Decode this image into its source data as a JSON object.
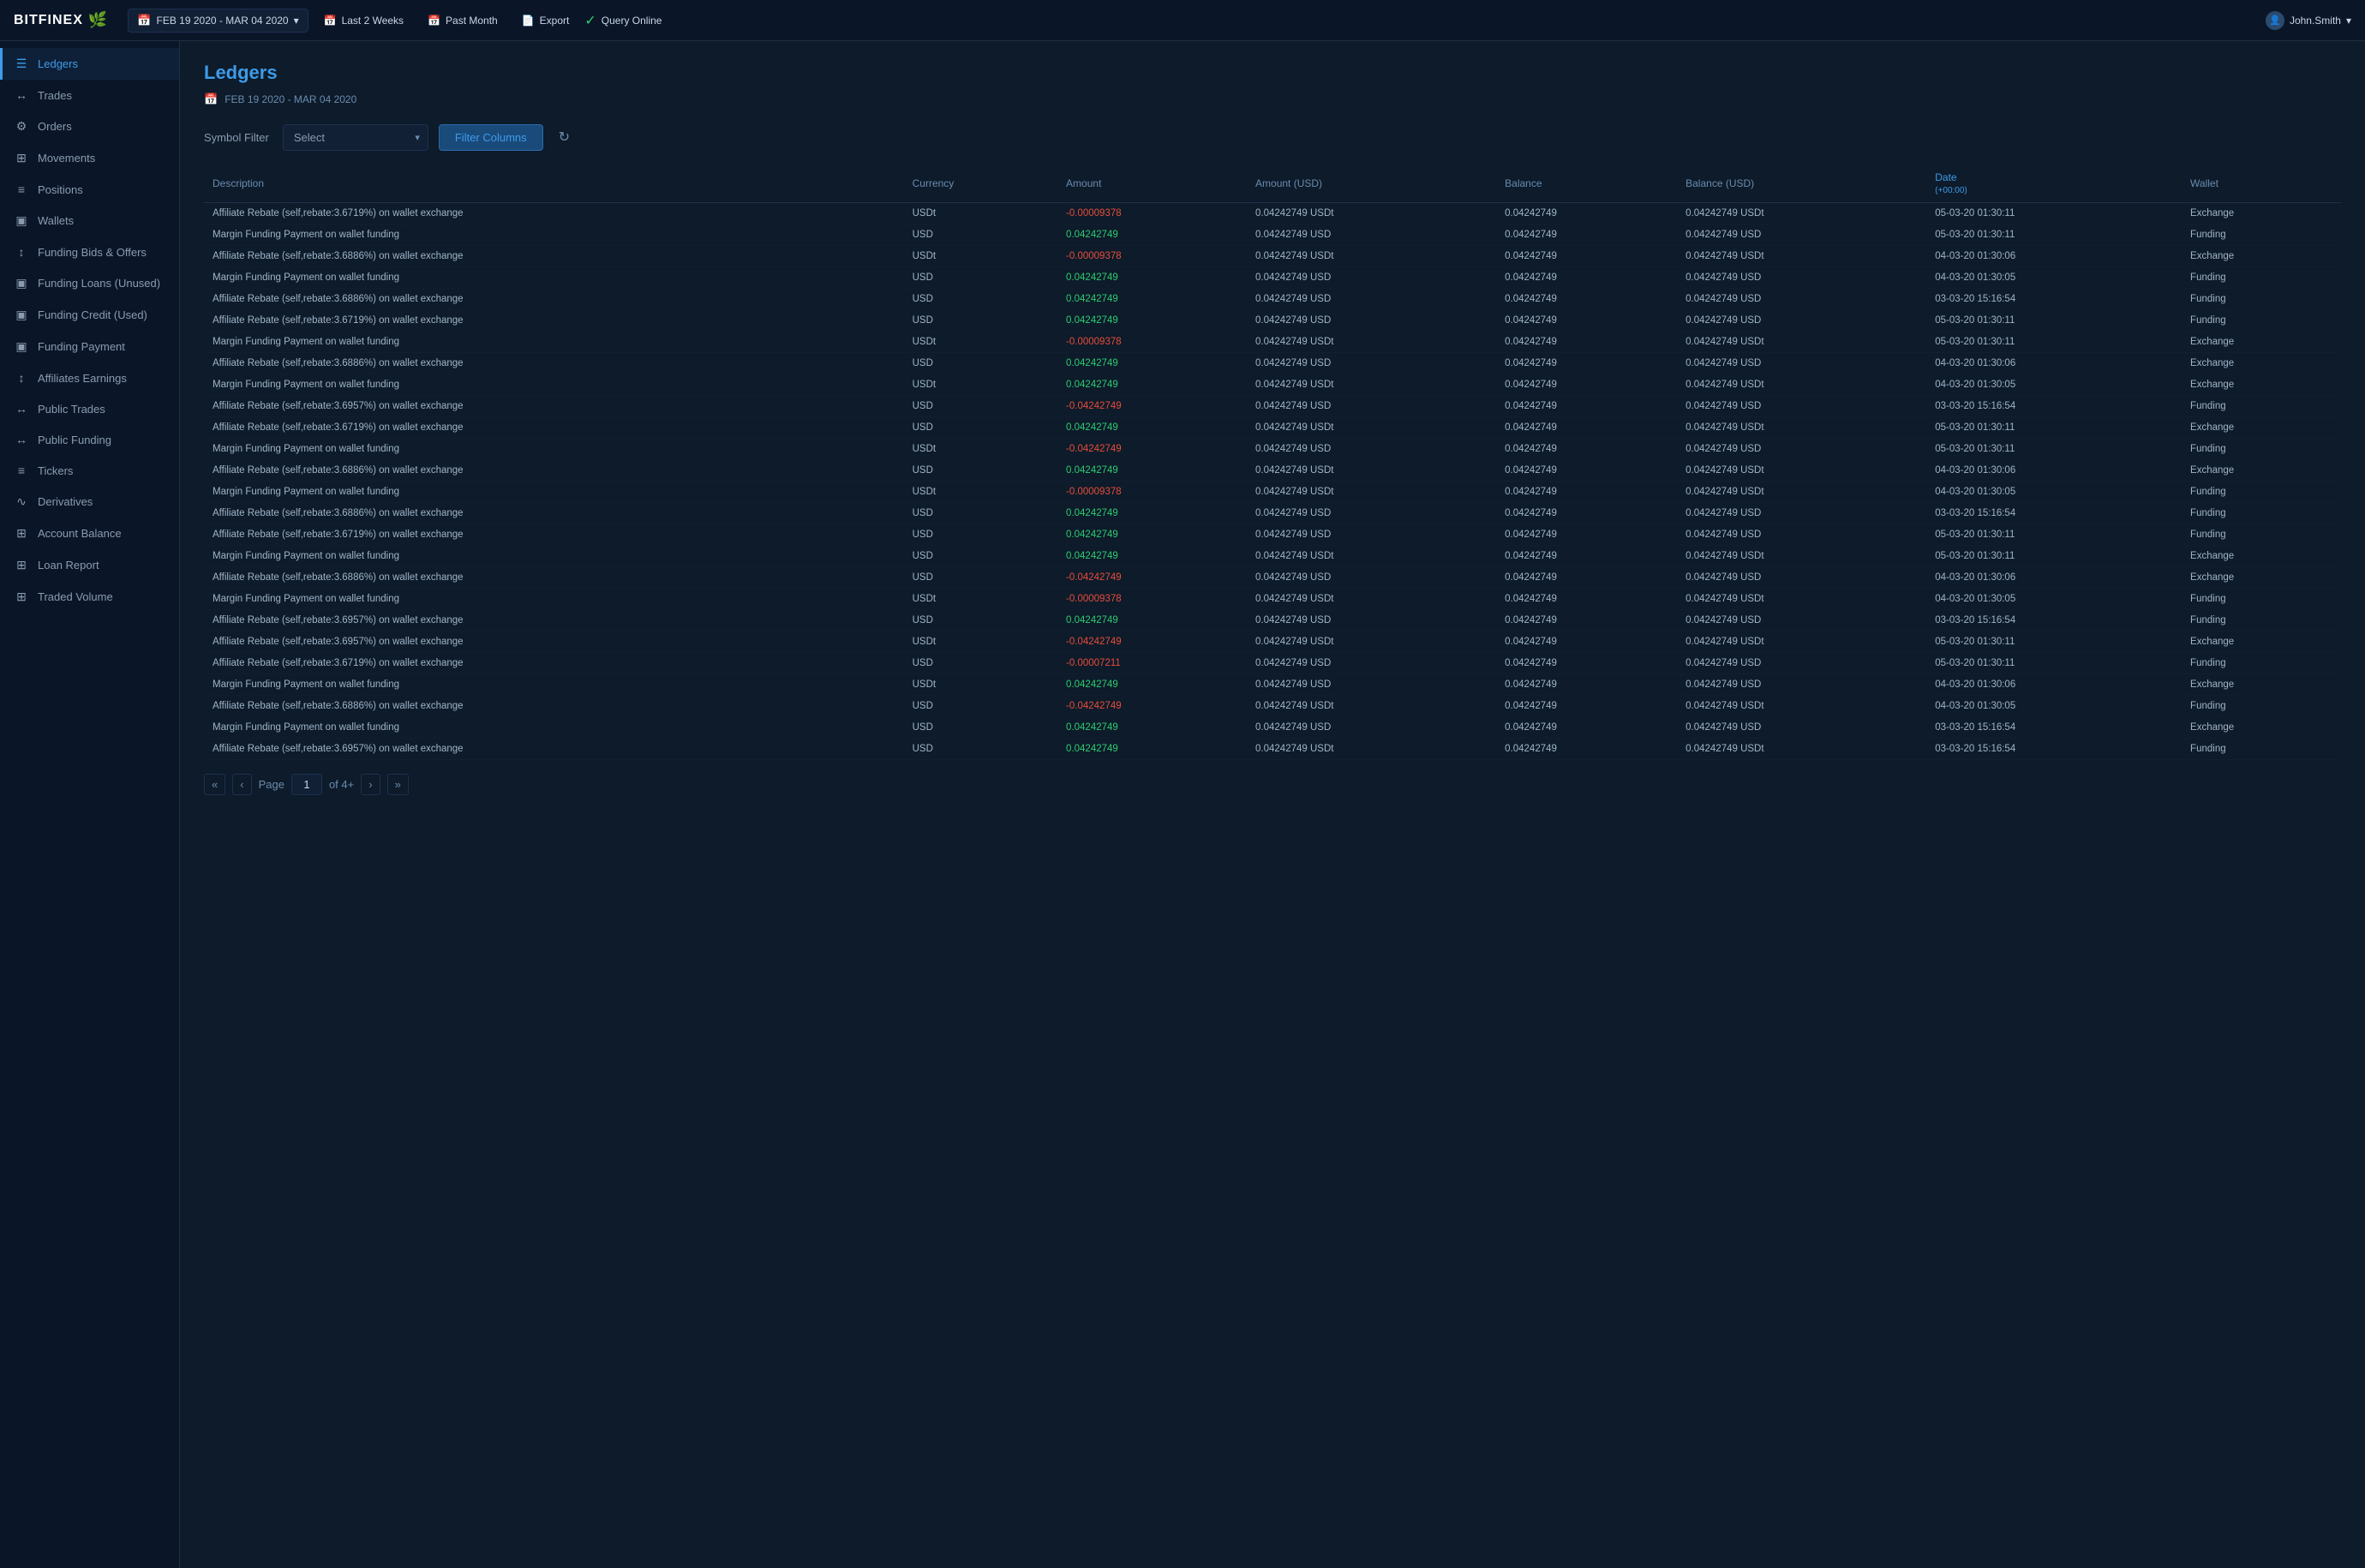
{
  "topnav": {
    "logo": "BITFINEX",
    "date_range": "FEB 19 2020 - MAR  04 2020",
    "last2weeks": "Last 2 Weeks",
    "past_month": "Past Month",
    "export": "Export",
    "query_online": "Query Online",
    "user": "John.Smith"
  },
  "sidebar": {
    "items": [
      {
        "label": "Ledgers",
        "icon": "☰",
        "active": true
      },
      {
        "label": "Trades",
        "icon": "↔"
      },
      {
        "label": "Orders",
        "icon": "⚙"
      },
      {
        "label": "Movements",
        "icon": "⊞"
      },
      {
        "label": "Positions",
        "icon": "≡"
      },
      {
        "label": "Wallets",
        "icon": "▣"
      },
      {
        "label": "Funding Bids & Offers",
        "icon": "↕"
      },
      {
        "label": "Funding Loans (Unused)",
        "icon": "▣"
      },
      {
        "label": "Funding Credit (Used)",
        "icon": "▣"
      },
      {
        "label": "Funding Payment",
        "icon": "▣"
      },
      {
        "label": "Affiliates Earnings",
        "icon": "↕"
      },
      {
        "label": "Public Trades",
        "icon": "↔"
      },
      {
        "label": "Public Funding",
        "icon": "↔"
      },
      {
        "label": "Tickers",
        "icon": "≡"
      },
      {
        "label": "Derivatives",
        "icon": "∿"
      },
      {
        "label": "Account Balance",
        "icon": "⊞"
      },
      {
        "label": "Loan Report",
        "icon": "⊞"
      },
      {
        "label": "Traded Volume",
        "icon": "⊞"
      }
    ]
  },
  "content": {
    "title": "Ledgers",
    "date_display": "FEB 19 2020 - MAR  04 2020",
    "symbol_filter_label": "Symbol Filter",
    "select_placeholder": "Select",
    "filter_btn": "Filter Columns",
    "columns": {
      "description": "Description",
      "currency": "Currency",
      "amount": "Amount",
      "amount_usd": "Amount (USD)",
      "balance": "Balance",
      "balance_usd": "Balance (USD)",
      "date": "Date",
      "date_sub": "(+00:00)",
      "wallet": "Wallet"
    },
    "rows": [
      {
        "desc": "Affiliate Rebate (self,rebate:3.6719%) on wallet exchange",
        "currency": "USDt",
        "amount": "-0.00009378",
        "amount_neg": true,
        "amount_usd": "0.04242749 USDt",
        "balance": "0.04242749",
        "balance_usd": "0.04242749 USDt",
        "date": "05-03-20 01:30:11",
        "wallet": "Exchange"
      },
      {
        "desc": "Margin Funding Payment on wallet funding",
        "currency": "USD",
        "amount": "0.04242749",
        "amount_neg": false,
        "amount_usd": "0.04242749 USD",
        "balance": "0.04242749",
        "balance_usd": "0.04242749 USD",
        "date": "05-03-20 01:30:11",
        "wallet": "Funding"
      },
      {
        "desc": "Affiliate Rebate (self,rebate:3.6886%) on wallet exchange",
        "currency": "USDt",
        "amount": "-0.00009378",
        "amount_neg": true,
        "amount_usd": "0.04242749 USDt",
        "balance": "0.04242749",
        "balance_usd": "0.04242749 USDt",
        "date": "04-03-20 01:30:06",
        "wallet": "Exchange"
      },
      {
        "desc": "Margin Funding Payment on wallet funding",
        "currency": "USD",
        "amount": "0.04242749",
        "amount_neg": false,
        "amount_usd": "0.04242749 USD",
        "balance": "0.04242749",
        "balance_usd": "0.04242749 USD",
        "date": "04-03-20 01:30:05",
        "wallet": "Funding"
      },
      {
        "desc": "Affiliate Rebate (self,rebate:3.6886%) on wallet exchange",
        "currency": "USD",
        "amount": "0.04242749",
        "amount_neg": false,
        "amount_usd": "0.04242749 USD",
        "balance": "0.04242749",
        "balance_usd": "0.04242749 USD",
        "date": "03-03-20 15:16:54",
        "wallet": "Funding"
      },
      {
        "desc": "Affiliate Rebate (self,rebate:3.6719%) on wallet exchange",
        "currency": "USD",
        "amount": "0.04242749",
        "amount_neg": false,
        "amount_usd": "0.04242749 USD",
        "balance": "0.04242749",
        "balance_usd": "0.04242749 USD",
        "date": "05-03-20 01:30:11",
        "wallet": "Funding"
      },
      {
        "desc": "Margin Funding Payment on wallet funding",
        "currency": "USDt",
        "amount": "-0.00009378",
        "amount_neg": true,
        "amount_usd": "0.04242749 USDt",
        "balance": "0.04242749",
        "balance_usd": "0.04242749 USDt",
        "date": "05-03-20 01:30:11",
        "wallet": "Exchange"
      },
      {
        "desc": "Affiliate Rebate (self,rebate:3.6886%) on wallet exchange",
        "currency": "USD",
        "amount": "0.04242749",
        "amount_neg": false,
        "amount_usd": "0.04242749 USD",
        "balance": "0.04242749",
        "balance_usd": "0.04242749 USD",
        "date": "04-03-20 01:30:06",
        "wallet": "Exchange"
      },
      {
        "desc": "Margin Funding Payment on wallet funding",
        "currency": "USDt",
        "amount": "0.04242749",
        "amount_neg": false,
        "amount_usd": "0.04242749 USDt",
        "balance": "0.04242749",
        "balance_usd": "0.04242749 USDt",
        "date": "04-03-20 01:30:05",
        "wallet": "Exchange"
      },
      {
        "desc": "Affiliate Rebate (self,rebate:3.6957%) on wallet exchange",
        "currency": "USD",
        "amount": "-0.04242749",
        "amount_neg": true,
        "amount_usd": "0.04242749 USD",
        "balance": "0.04242749",
        "balance_usd": "0.04242749 USD",
        "date": "03-03-20 15:16:54",
        "wallet": "Funding"
      },
      {
        "desc": "Affiliate Rebate (self,rebate:3.6719%) on wallet exchange",
        "currency": "USD",
        "amount": "0.04242749",
        "amount_neg": false,
        "amount_usd": "0.04242749 USDt",
        "balance": "0.04242749",
        "balance_usd": "0.04242749 USDt",
        "date": "05-03-20 01:30:11",
        "wallet": "Exchange"
      },
      {
        "desc": "Margin Funding Payment on wallet funding",
        "currency": "USDt",
        "amount": "-0.04242749",
        "amount_neg": true,
        "amount_usd": "0.04242749 USD",
        "balance": "0.04242749",
        "balance_usd": "0.04242749 USD",
        "date": "05-03-20 01:30:11",
        "wallet": "Funding"
      },
      {
        "desc": "Affiliate Rebate (self,rebate:3.6886%) on wallet exchange",
        "currency": "USD",
        "amount": "0.04242749",
        "amount_neg": false,
        "amount_usd": "0.04242749 USDt",
        "balance": "0.04242749",
        "balance_usd": "0.04242749 USDt",
        "date": "04-03-20 01:30:06",
        "wallet": "Exchange"
      },
      {
        "desc": "Margin Funding Payment on wallet funding",
        "currency": "USDt",
        "amount": "-0.00009378",
        "amount_neg": true,
        "amount_usd": "0.04242749 USDt",
        "balance": "0.04242749",
        "balance_usd": "0.04242749 USDt",
        "date": "04-03-20 01:30:05",
        "wallet": "Funding"
      },
      {
        "desc": "Affiliate Rebate (self,rebate:3.6886%) on wallet exchange",
        "currency": "USD",
        "amount": "0.04242749",
        "amount_neg": false,
        "amount_usd": "0.04242749 USD",
        "balance": "0.04242749",
        "balance_usd": "0.04242749 USD",
        "date": "03-03-20 15:16:54",
        "wallet": "Funding"
      },
      {
        "desc": "Affiliate Rebate (self,rebate:3.6719%) on wallet exchange",
        "currency": "USD",
        "amount": "0.04242749",
        "amount_neg": false,
        "amount_usd": "0.04242749 USD",
        "balance": "0.04242749",
        "balance_usd": "0.04242749 USD",
        "date": "05-03-20 01:30:11",
        "wallet": "Funding"
      },
      {
        "desc": "Margin Funding Payment on wallet funding",
        "currency": "USD",
        "amount": "0.04242749",
        "amount_neg": false,
        "amount_usd": "0.04242749 USDt",
        "balance": "0.04242749",
        "balance_usd": "0.04242749 USDt",
        "date": "05-03-20 01:30:11",
        "wallet": "Exchange"
      },
      {
        "desc": "Affiliate Rebate (self,rebate:3.6886%) on wallet exchange",
        "currency": "USD",
        "amount": "-0.04242749",
        "amount_neg": true,
        "amount_usd": "0.04242749 USD",
        "balance": "0.04242749",
        "balance_usd": "0.04242749 USD",
        "date": "04-03-20 01:30:06",
        "wallet": "Exchange"
      },
      {
        "desc": "Margin Funding Payment on wallet funding",
        "currency": "USDt",
        "amount": "-0.00009378",
        "amount_neg": true,
        "amount_usd": "0.04242749 USDt",
        "balance": "0.04242749",
        "balance_usd": "0.04242749 USDt",
        "date": "04-03-20 01:30:05",
        "wallet": "Funding"
      },
      {
        "desc": "Affiliate Rebate (self,rebate:3.6957%) on wallet exchange",
        "currency": "USD",
        "amount": "0.04242749",
        "amount_neg": false,
        "amount_usd": "0.04242749 USD",
        "balance": "0.04242749",
        "balance_usd": "0.04242749 USD",
        "date": "03-03-20 15:16:54",
        "wallet": "Funding"
      },
      {
        "desc": "Affiliate Rebate (self,rebate:3.6957%) on wallet exchange",
        "currency": "USDt",
        "amount": "-0.04242749",
        "amount_neg": true,
        "amount_usd": "0.04242749 USDt",
        "balance": "0.04242749",
        "balance_usd": "0.04242749 USDt",
        "date": "05-03-20 01:30:11",
        "wallet": "Exchange"
      },
      {
        "desc": "Affiliate Rebate (self,rebate:3.6719%) on wallet exchange",
        "currency": "USD",
        "amount": "-0.00007211",
        "amount_neg": true,
        "amount_usd": "0.04242749 USD",
        "balance": "0.04242749",
        "balance_usd": "0.04242749 USD",
        "date": "05-03-20 01:30:11",
        "wallet": "Funding"
      },
      {
        "desc": "Margin Funding Payment on wallet funding",
        "currency": "USDt",
        "amount": "0.04242749",
        "amount_neg": false,
        "amount_usd": "0.04242749 USD",
        "balance": "0.04242749",
        "balance_usd": "0.04242749 USD",
        "date": "04-03-20 01:30:06",
        "wallet": "Exchange"
      },
      {
        "desc": "Affiliate Rebate (self,rebate:3.6886%) on wallet exchange",
        "currency": "USD",
        "amount": "-0.04242749",
        "amount_neg": true,
        "amount_usd": "0.04242749 USDt",
        "balance": "0.04242749",
        "balance_usd": "0.04242749 USDt",
        "date": "04-03-20 01:30:05",
        "wallet": "Funding"
      },
      {
        "desc": "Margin Funding Payment on wallet funding",
        "currency": "USD",
        "amount": "0.04242749",
        "amount_neg": false,
        "amount_usd": "0.04242749 USD",
        "balance": "0.04242749",
        "balance_usd": "0.04242749 USD",
        "date": "03-03-20 15:16:54",
        "wallet": "Exchange"
      },
      {
        "desc": "Affiliate Rebate (self,rebate:3.6957%) on wallet exchange",
        "currency": "USD",
        "amount": "0.04242749",
        "amount_neg": false,
        "amount_usd": "0.04242749 USDt",
        "balance": "0.04242749",
        "balance_usd": "0.04242749 USDt",
        "date": "03-03-20 15:16:54",
        "wallet": "Funding"
      }
    ],
    "pagination": {
      "first": "«",
      "prev": "‹",
      "page_label": "Page",
      "current_page": "1",
      "of_pages": "of 4+",
      "next": "›",
      "last": "»"
    }
  }
}
